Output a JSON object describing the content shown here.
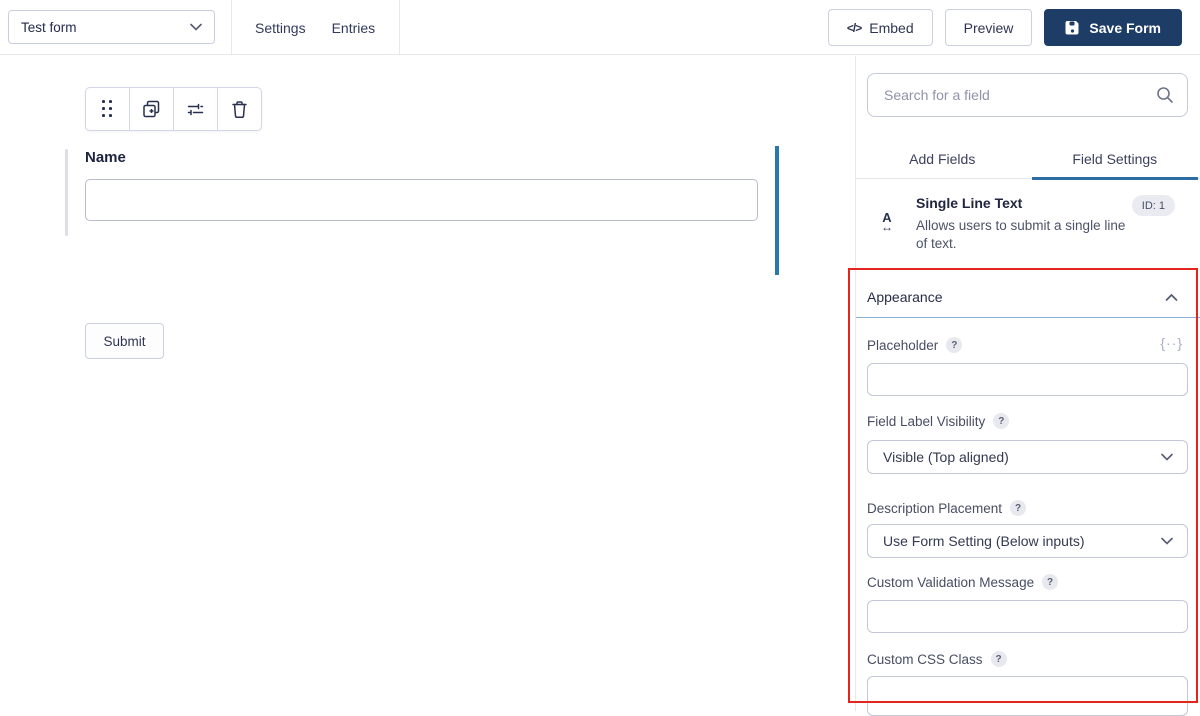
{
  "header": {
    "form_selector_value": "Test form",
    "nav": [
      {
        "label": "Settings"
      },
      {
        "label": "Entries"
      }
    ],
    "embed_icon_text": "</>",
    "embed_label": "Embed",
    "preview_label": "Preview",
    "save_label": "Save Form"
  },
  "canvas": {
    "field_label": "Name",
    "submit_label": "Submit"
  },
  "sidebar": {
    "search_placeholder": "Search for a field",
    "tabs": [
      {
        "label": "Add Fields",
        "active": false
      },
      {
        "label": "Field Settings",
        "active": true
      }
    ],
    "selected_field": {
      "icon": "single-line-text-icon",
      "icon_letter": "A",
      "icon_arrow": "↔",
      "title": "Single Line Text",
      "description": "Allows users to submit a single line of text.",
      "id_badge": "ID: 1"
    },
    "appearance": {
      "title": "Appearance",
      "help_glyph": "?",
      "merge_tag_glyph": "{··}",
      "fields": [
        {
          "label": "Placeholder",
          "type": "text",
          "value": ""
        },
        {
          "label": "Field Label Visibility",
          "type": "select",
          "value": "Visible (Top aligned)"
        },
        {
          "label": "Description Placement",
          "type": "select",
          "value": "Use Form Setting (Below inputs)"
        },
        {
          "label": "Custom Validation Message",
          "type": "text",
          "value": ""
        },
        {
          "label": "Custom CSS Class",
          "type": "text",
          "value": ""
        }
      ]
    }
  },
  "colors": {
    "save_button_bg": "#1d3c66",
    "active_tab_underline": "#2c6da4",
    "field_selection_bar": "#2779ae",
    "section_divider_blue": "#8fb1d8",
    "annotation_red": "#e3261d"
  }
}
